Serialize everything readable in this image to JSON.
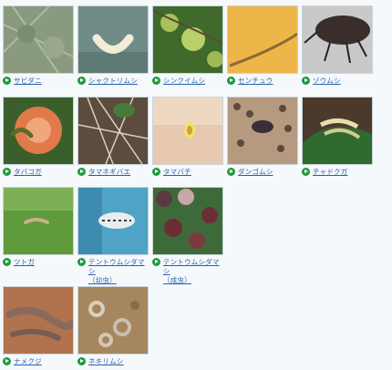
{
  "pests": [
    {
      "label": "サビダニ"
    },
    {
      "label": "シャクトリムシ"
    },
    {
      "label": "シンクイムシ"
    },
    {
      "label": "センチュウ"
    },
    {
      "label": "ゾウムシ"
    },
    {
      "label": "タバコガ"
    },
    {
      "label": "タマネギバエ"
    },
    {
      "label": "タマバチ"
    },
    {
      "label": "ダンゴムシ"
    },
    {
      "label": "チャドクガ"
    },
    {
      "label": "ツトガ"
    },
    {
      "label": "テントウムシダマシ\n（幼虫）"
    },
    {
      "label": "テントウムシダマシ\n（成虫）"
    },
    {
      "label": "ナメクジ"
    },
    {
      "label": "ネキリムシ"
    }
  ]
}
